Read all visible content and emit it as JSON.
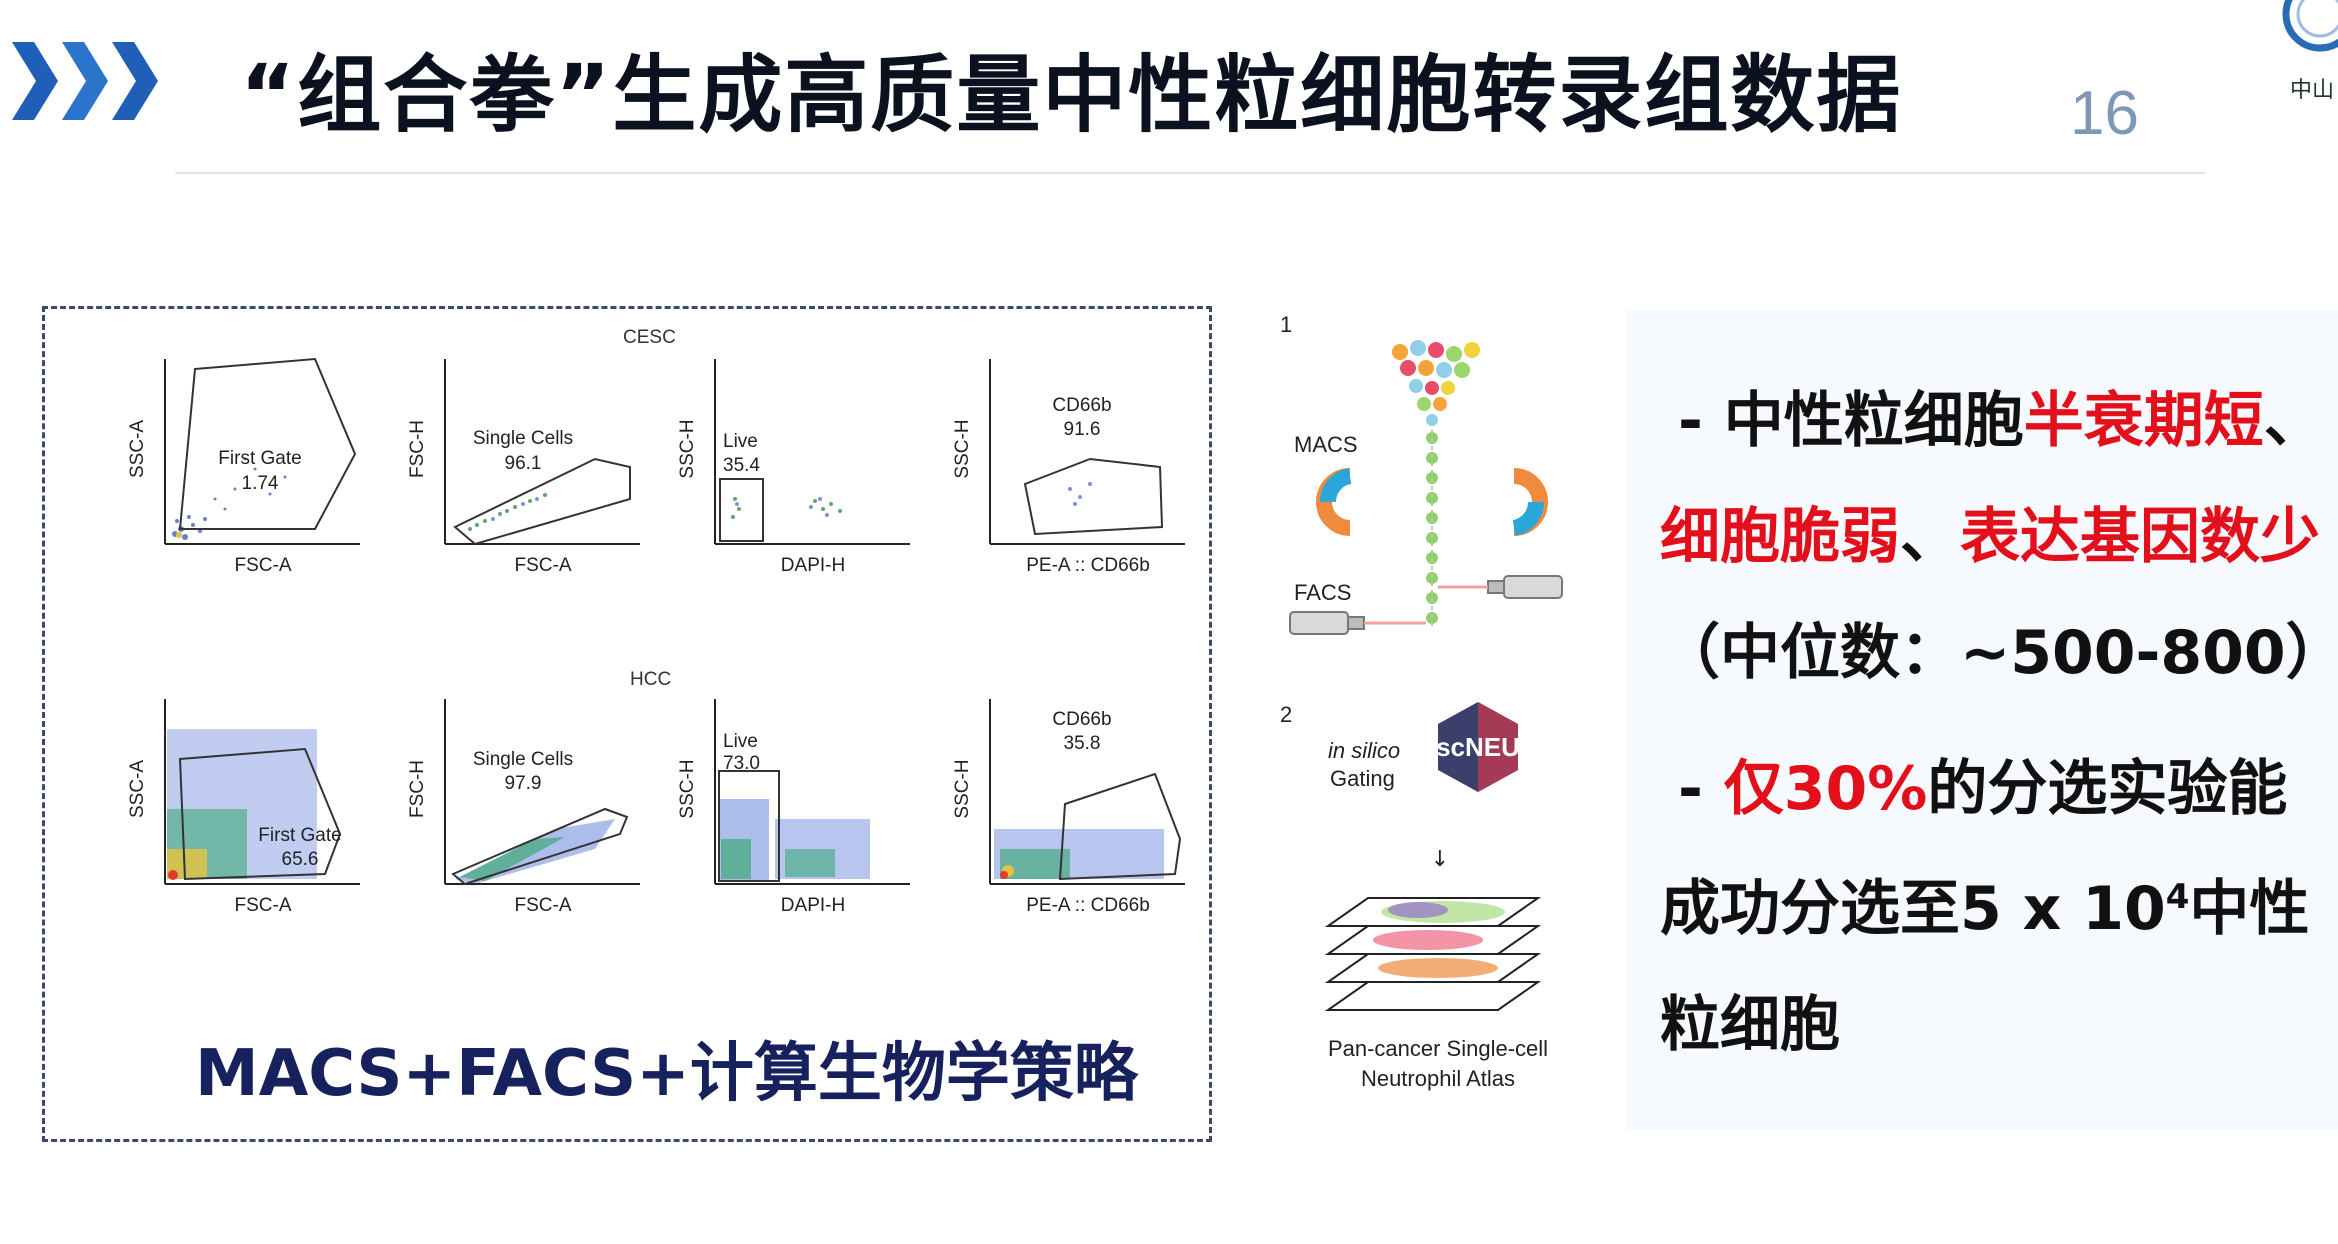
{
  "header": {
    "title": "“组合拳”生成高质量中性粒细胞转录组数据",
    "page_number": "16",
    "logo_text": "中山"
  },
  "facs": {
    "cohorts": [
      {
        "name": "CESC",
        "plots": [
          {
            "ylabel": "SSC-A",
            "xlabel": "FSC-A",
            "gate_name": "First Gate",
            "gate_value": "1.74"
          },
          {
            "ylabel": "FSC-H",
            "xlabel": "FSC-A",
            "gate_name": "Single Cells",
            "gate_value": "96.1"
          },
          {
            "ylabel": "SSC-H",
            "xlabel": "DAPI-H",
            "gate_name": "Live",
            "gate_value": "35.4"
          },
          {
            "ylabel": "SSC-H",
            "xlabel": "PE-A :: CD66b",
            "gate_name": "CD66b",
            "gate_value": "91.6"
          }
        ]
      },
      {
        "name": "HCC",
        "plots": [
          {
            "ylabel": "SSC-A",
            "xlabel": "FSC-A",
            "gate_name": "First Gate",
            "gate_value": "65.6"
          },
          {
            "ylabel": "FSC-H",
            "xlabel": "FSC-A",
            "gate_name": "Single Cells",
            "gate_value": "97.9"
          },
          {
            "ylabel": "SSC-H",
            "xlabel": "DAPI-H",
            "gate_name": "Live",
            "gate_value": "73.0"
          },
          {
            "ylabel": "SSC-H",
            "xlabel": "PE-A :: CD66b",
            "gate_name": "CD66b",
            "gate_value": "35.8"
          }
        ]
      }
    ],
    "strategy": "MACS+FACS+计算生物学策略"
  },
  "diagram": {
    "step1": "1",
    "step2": "2",
    "macs": "MACS",
    "facs": "FACS",
    "in_silico": "in silico",
    "gating": "Gating",
    "badge": "scNEU",
    "arrow": "↓",
    "atlas_line1": "Pan-cancer Single-cell",
    "atlas_line2": "Neutrophil Atlas"
  },
  "info": {
    "line1": {
      "prefix": "- 中性粒细胞",
      "red": "半衰期短",
      "suffix": "、"
    },
    "line2": {
      "red1": "细胞脆弱",
      "mid": "、",
      "red2": "表达基因数少"
    },
    "line3": "（中位数：~500-800）",
    "line4": {
      "prefix": "- ",
      "red": "仅30%",
      "suffix": "的分选实验能"
    },
    "line5": {
      "text": "成功分选至5 x 10",
      "sup": "4",
      "suffix": "中性"
    },
    "line6": "粒细胞"
  },
  "colors": {
    "title": "#0c1120",
    "accent_red": "#e3101c",
    "strategy_text": "#17215e",
    "chevron": "#1f5fb8",
    "page_number": "#7d97b5"
  }
}
